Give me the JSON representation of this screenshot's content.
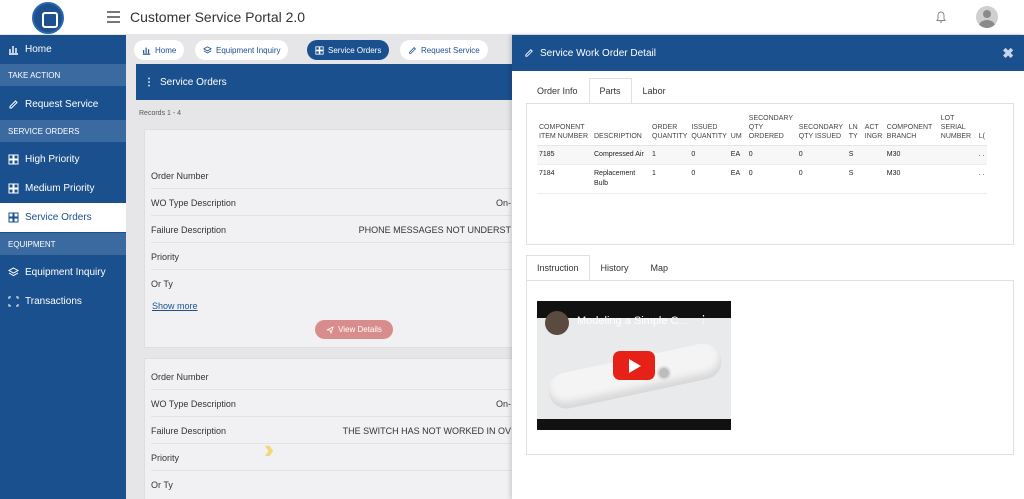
{
  "app": {
    "title": "Customer Service Portal 2.0"
  },
  "sidebar": {
    "home": "Home",
    "section_take_action": "TAKE ACTION",
    "request_service": "Request Service",
    "section_service_orders": "SERVICE ORDERS",
    "high_priority": "High Priority",
    "medium_priority": "Medium Priority",
    "service_orders": "Service Orders",
    "section_equipment": "EQUIPMENT",
    "equipment_inquiry": "Equipment Inquiry",
    "transactions": "Transactions"
  },
  "tabs": {
    "home": "Home",
    "equipment_inquiry": "Equipment Inquiry",
    "service_orders": "Service Orders",
    "request_service": "Request Service"
  },
  "list": {
    "header": "Service Orders",
    "records": "Records  1 - 4",
    "cards": [
      {
        "order_number_label": "Order Number",
        "wo_type_label": "WO Type Description",
        "wo_type_value": "On-",
        "failure_label": "Failure Description",
        "failure_value": "PHONE MESSAGES NOT UNDERST",
        "priority_label": "Priority",
        "or_ty_label": "Or Ty",
        "show_more": "Show more",
        "view_details": "View Details"
      },
      {
        "order_number_label": "Order Number",
        "wo_type_label": "WO Type Description",
        "wo_type_value": "On-",
        "failure_label": "Failure Description",
        "failure_value": "THE SWITCH HAS NOT WORKED IN OV",
        "priority_label": "Priority",
        "or_ty_label": "Or Ty"
      }
    ]
  },
  "panel": {
    "title": "Service Work Order Detail",
    "close": "✖",
    "top_tabs": [
      "Order Info",
      "Parts",
      "Labor"
    ],
    "active_top_tab": "Parts",
    "parts_table": {
      "headers": [
        "COMPONENT ITEM NUMBER",
        "DESCRIPTION",
        "ORDER QUANTITY",
        "ISSUED QUANTITY",
        "UM",
        "SECONDARY QTY ORDERED",
        "SECONDARY QTY ISSUED",
        "LN TY",
        "ACT INGR",
        "COMPONENT BRANCH",
        "LOT SERIAL NUMBER",
        "L("
      ],
      "rows": [
        [
          "7185",
          "Compressed Air",
          "1",
          "0",
          "EA",
          "0",
          "0",
          "S",
          "",
          "M30",
          "",
          ". ."
        ],
        [
          "7184",
          "Replacement Bulb",
          "1",
          "0",
          "EA",
          "0",
          "0",
          "S",
          "",
          "M30",
          "",
          ". ."
        ]
      ]
    },
    "bottom_tabs": [
      "Instruction",
      "History",
      "Map"
    ],
    "active_bottom_tab": "Instruction",
    "video": {
      "title": "Modeling a Simple C...",
      "menu": "⋮"
    }
  }
}
